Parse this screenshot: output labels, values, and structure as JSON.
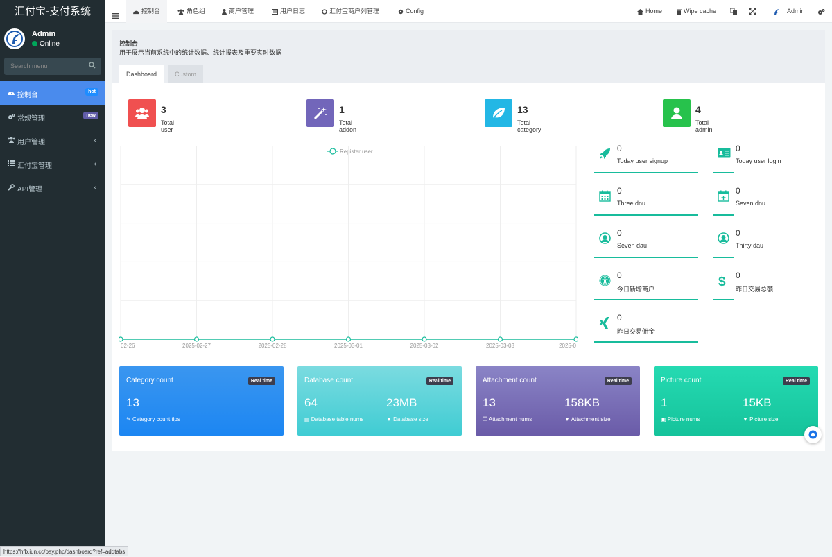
{
  "app": {
    "title": "汇付宝-支付系统"
  },
  "user": {
    "name": "Admin",
    "status": "Online"
  },
  "sidebar": {
    "search_placeholder": "Search menu",
    "items": [
      {
        "label": "控制台",
        "badge": "hot",
        "badge_color": "#1e8dff",
        "active": true
      },
      {
        "label": "常规管理",
        "badge": "new",
        "badge_color": "#605ca8"
      },
      {
        "label": "用户管理",
        "chevron": "‹"
      },
      {
        "label": "汇付宝管理",
        "chevron": "‹"
      },
      {
        "label": "API管理",
        "chevron": "‹"
      }
    ]
  },
  "topbar": {
    "tabs": [
      "控制台",
      "角色组",
      "商户管理",
      "用户日志",
      "汇付宝商户列管理",
      "Config"
    ],
    "right": {
      "home": "Home",
      "wipe": "Wipe cache",
      "admin": "Admin"
    }
  },
  "page": {
    "title": "控制台",
    "description": "用于展示当前系统中的统计数据、统计报表及重要实时数据",
    "tabs": [
      "Dashboard",
      "Custom"
    ]
  },
  "stats": [
    {
      "value": "3",
      "label": "Total user",
      "color": "#f05050",
      "icon": "users-icon"
    },
    {
      "value": "1",
      "label": "Total addon",
      "color": "#7266ba",
      "icon": "magic-icon"
    },
    {
      "value": "13",
      "label": "Total category",
      "color": "#23b7e5",
      "icon": "leaf-icon"
    },
    {
      "value": "4",
      "label": "Total admin",
      "color": "#27c24c",
      "icon": "user-icon"
    }
  ],
  "mini_stats": [
    {
      "value": "0",
      "label": "Today user signup",
      "icon": "rocket-icon"
    },
    {
      "value": "0",
      "label": "Today user login",
      "icon": "vcard-icon"
    },
    {
      "value": "0",
      "label": "Three dnu",
      "icon": "calendar-icon"
    },
    {
      "value": "0",
      "label": "Seven dnu",
      "icon": "calendar-plus-icon"
    },
    {
      "value": "0",
      "label": "Seven dau",
      "icon": "user-circle-icon"
    },
    {
      "value": "0",
      "label": "Thirty dau",
      "icon": "user-circle-icon"
    },
    {
      "value": "0",
      "label": "今日新增商户",
      "icon": "universal-access-icon"
    },
    {
      "value": "0",
      "label": "昨日交易总额",
      "icon": "dollar-icon"
    },
    {
      "value": "0",
      "label": "昨日交易佣金",
      "icon": "xing-icon"
    }
  ],
  "cards": [
    {
      "title": "Category count",
      "badge": "Real time",
      "v1": "13",
      "s1": "Category count tips",
      "v2": "",
      "s2": "",
      "c1": "#3a96f0",
      "c2": "#1c86f2"
    },
    {
      "title": "Database count",
      "badge": "Real time",
      "v1": "64",
      "s1": "Database table nums",
      "v2": "23MB",
      "s2": "Database size",
      "c1": "#7bdbe0",
      "c2": "#3fccd3"
    },
    {
      "title": "Attachment count",
      "badge": "Real time",
      "v1": "13",
      "s1": "Attachment nums",
      "v2": "158KB",
      "s2": "Attachment size",
      "c1": "#8a84c6",
      "c2": "#6a5ba8"
    },
    {
      "title": "Picture count",
      "badge": "Real time",
      "v1": "1",
      "s1": "Picture nums",
      "v2": "15KB",
      "s2": "Picture size",
      "c1": "#25dab2",
      "c2": "#15c39b"
    }
  ],
  "chart_data": {
    "type": "line",
    "x": [
      "02-26",
      "2025-02-27",
      "2025-02-28",
      "2025-03-01",
      "2025-03-02",
      "2025-03-03",
      "2025-0"
    ],
    "series": [
      {
        "name": "Register user",
        "values": [
          0,
          0,
          0,
          0,
          0,
          0,
          0
        ],
        "color": "#18bc9c"
      }
    ],
    "grid": true,
    "legend": "top-center"
  },
  "status_url": "https://hfb.iun.cc/pay.php/dashboard?ref=addtabs"
}
